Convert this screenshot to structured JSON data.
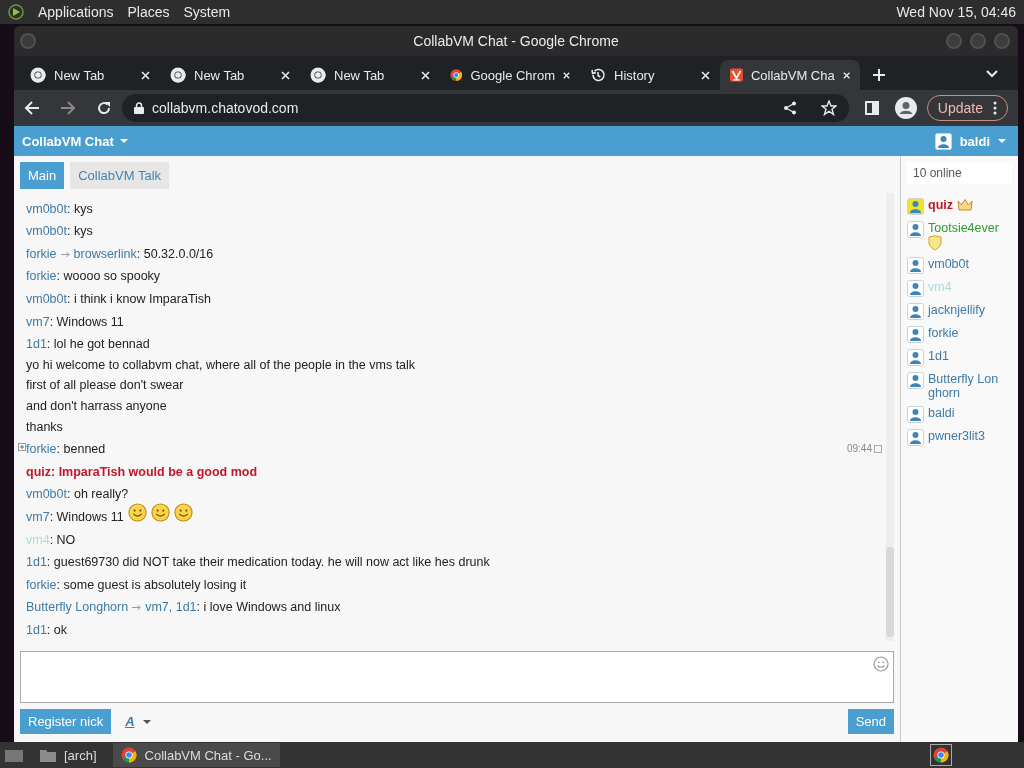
{
  "top_panel": {
    "menus": [
      "Applications",
      "Places",
      "System"
    ],
    "clock": "Wed Nov 15, 04:46"
  },
  "window": {
    "title": "CollabVM Chat - Google Chrome"
  },
  "tabs": [
    {
      "label": "New Tab",
      "kind": "newtab",
      "selected": false
    },
    {
      "label": "New Tab",
      "kind": "newtab",
      "selected": false
    },
    {
      "label": "New Tab",
      "kind": "newtab",
      "selected": false
    },
    {
      "label": "Google Chrom",
      "kind": "chrome",
      "selected": false
    },
    {
      "label": "History",
      "kind": "history",
      "selected": false
    },
    {
      "label": "CollabVM Cha",
      "kind": "site",
      "selected": true
    }
  ],
  "address_bar": {
    "url": "collabvm.chatovod.com"
  },
  "update_button": "Update",
  "chat": {
    "title": "CollabVM Chat",
    "user": "baldi",
    "rooms": [
      {
        "label": "Main",
        "selected": true
      },
      {
        "label": "CollabVM Talk",
        "selected": false
      }
    ],
    "messages": [
      {
        "kind": "chat",
        "from": "vm0b0t",
        "text": ": kys"
      },
      {
        "kind": "chat",
        "from": "vm0b0t",
        "text": ": kys"
      },
      {
        "kind": "chat",
        "from": "forkie",
        "to": "browserlink",
        "text": ": 50.32.0.0/16"
      },
      {
        "kind": "chat",
        "from": "forkie",
        "text": ": woooo so spooky"
      },
      {
        "kind": "chat",
        "from": "vm0b0t",
        "text": ": i think i know ImparaTish"
      },
      {
        "kind": "chat",
        "from": "vm7",
        "text": ": Windows 11"
      },
      {
        "kind": "chat",
        "from": "1d1",
        "text": ": lol he got bennad"
      },
      {
        "kind": "notice",
        "text": "yo hi welcome to collabvm chat, where all of the people in the vms talk"
      },
      {
        "kind": "notice",
        "text": "first of all please don't swear"
      },
      {
        "kind": "notice",
        "text": "and don't harrass anyone"
      },
      {
        "kind": "notice",
        "text": "thanks"
      },
      {
        "kind": "chat",
        "from": "forkie",
        "text": ": benned",
        "time": "09:44"
      },
      {
        "kind": "admin",
        "from": "quiz",
        "text": ": ImparaTish would be a good mod"
      },
      {
        "kind": "chat",
        "from": "vm0b0t",
        "text": ": oh really?"
      },
      {
        "kind": "chat",
        "from": "vm7",
        "text": ": Windows 11",
        "emoticons": [
          {
            "kind": "smiley"
          },
          {
            "kind": "smiley"
          },
          {
            "kind": "smiley"
          }
        ]
      },
      {
        "kind": "guest",
        "from": "vm4",
        "text": ": NO"
      },
      {
        "kind": "chat",
        "from": "1d1",
        "text": ": guest69730 did NOT take their medication today. he will now act like hes drunk"
      },
      {
        "kind": "chat",
        "from": "forkie",
        "text": ": some guest is absolutely losing it"
      },
      {
        "kind": "chat",
        "from": "Butterfly Longhorn",
        "to": "vm7, 1d1",
        "text": ": i love Windows and linux"
      },
      {
        "kind": "chat",
        "from": "1d1",
        "text": ": ok"
      }
    ],
    "register_button": "Register nick",
    "font_button": "A",
    "send_button": "Send",
    "online_count": "10 online",
    "users": [
      {
        "name": "quiz",
        "kind": "admin",
        "badges": [
          {
            "kind": "crown"
          }
        ]
      },
      {
        "name": "Tootsie4ever",
        "kind": "moderator",
        "badges": [
          {
            "kind": "shield"
          }
        ]
      },
      {
        "name": "vm0b0t",
        "kind": "user"
      },
      {
        "name": "vm4",
        "kind": "guest"
      },
      {
        "name": "jacknjellify",
        "kind": "user"
      },
      {
        "name": "forkie",
        "kind": "user"
      },
      {
        "name": "1d1",
        "kind": "user"
      },
      {
        "name": "Butterfly Lon ghorn",
        "kind": "user"
      },
      {
        "name": "baldi",
        "kind": "user"
      },
      {
        "name": "pwner3lit3",
        "kind": "user"
      }
    ]
  },
  "taskbar": {
    "items": [
      {
        "label": "[arch]",
        "kind": "folder",
        "selected": false
      },
      {
        "label": "CollabVM Chat - Go...",
        "kind": "chrome",
        "selected": true
      }
    ]
  }
}
